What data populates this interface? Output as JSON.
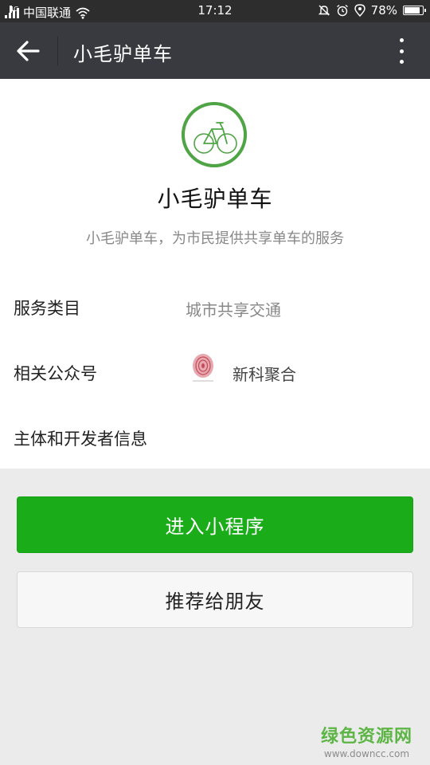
{
  "status_bar": {
    "network_type": "4G",
    "carrier": "中国联通",
    "time": "17:12",
    "battery_percent": "78%",
    "battery_level": 0.78,
    "icons": [
      "signal-icon",
      "wifi-icon",
      "mute-icon",
      "alarm-icon",
      "location-icon",
      "battery-icon"
    ]
  },
  "title_bar": {
    "title": "小毛驴单车",
    "back_icon": "arrow-left-icon",
    "more_icon": "more-vertical-icon"
  },
  "profile": {
    "name": "小毛驴单车",
    "description": "小毛驴单车，为市民提供共享单车的服务",
    "logo_color": "#4fa545"
  },
  "info": {
    "category_label": "服务类目",
    "category_value": "城市共享交通",
    "account_label": "相关公众号",
    "account_name": "新科聚合",
    "developer_label": "主体和开发者信息"
  },
  "actions": {
    "enter_label": "进入小程序",
    "recommend_label": "推荐给朋友",
    "primary_color": "#1aad19"
  },
  "watermark": {
    "title": "绿色资源网",
    "url": "www.downcc.com"
  }
}
